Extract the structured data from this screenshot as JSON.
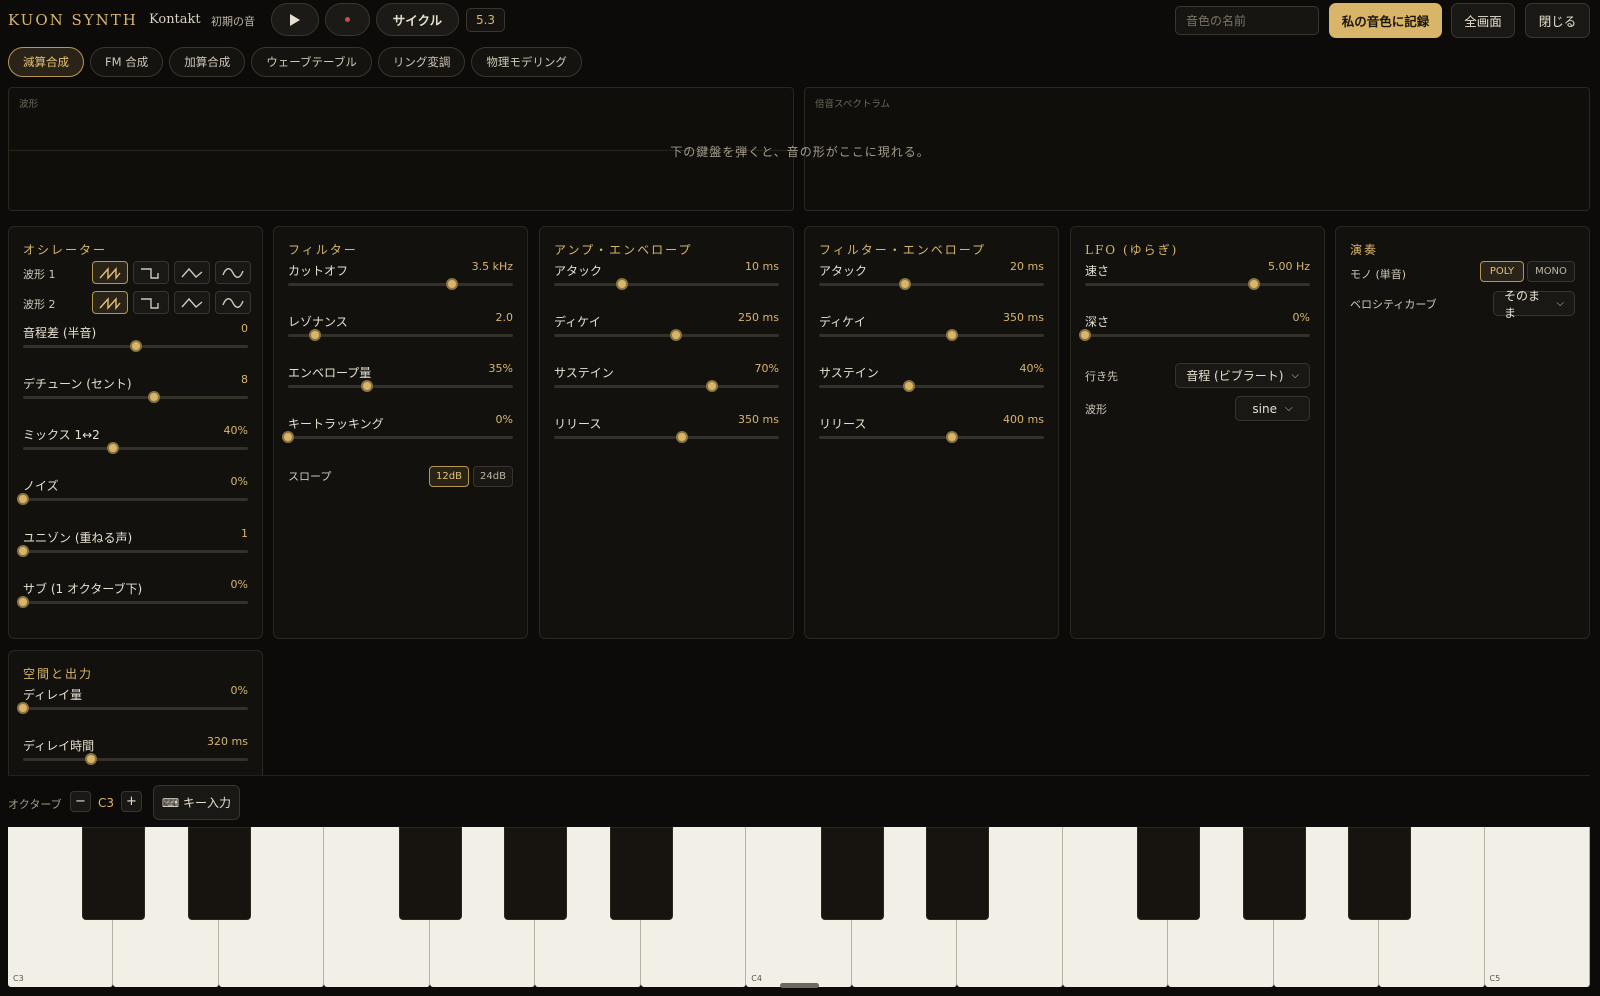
{
  "header": {
    "brand": "KUON SYNTH",
    "engine": "Kontakt",
    "preset_name": "初期の音",
    "cycle_label": "サイクル",
    "bpm_value": "5.3",
    "name_placeholder": "音色の名前",
    "save_label": "私の音色に記録",
    "fullscreen_label": "全画面",
    "close_label": "閉じる"
  },
  "synth_tabs": [
    {
      "label": "減算合成",
      "active": true
    },
    {
      "label": "FM 合成",
      "active": false
    },
    {
      "label": "加算合成",
      "active": false
    },
    {
      "label": "ウェーブテーブル",
      "active": false
    },
    {
      "label": "リング変調",
      "active": false
    },
    {
      "label": "物理モデリング",
      "active": false
    }
  ],
  "displays": {
    "waveform_label": "波形",
    "spectrum_label": "倍音スペクトラム",
    "hint": "下の鍵盤を弾くと、音の形がここに現れる。"
  },
  "oscillator": {
    "title": "オシレーター",
    "wave1_label": "波形 1",
    "wave2_label": "波形 2",
    "wave_options": [
      "saw",
      "square",
      "triangle",
      "sine"
    ],
    "wave1_selected": "saw",
    "wave2_selected": "saw",
    "params": [
      {
        "label": "音程差 (半音)",
        "value": "0",
        "level": 0.5
      },
      {
        "label": "デチューン (セント)",
        "value": "8",
        "level": 0.58
      },
      {
        "label": "ミックス 1↔2",
        "value": "40%",
        "level": 0.4
      },
      {
        "label": "ノイズ",
        "value": "0%",
        "level": 0.0
      },
      {
        "label": "ユニゾン (重ねる声)",
        "value": "1",
        "level": 0.0
      },
      {
        "label": "サブ (1 オクターブ下)",
        "value": "0%",
        "level": 0.0
      }
    ]
  },
  "filter": {
    "title": "フィルター",
    "params": [
      {
        "label": "カットオフ",
        "value": "3.5 kHz",
        "level": 0.73
      },
      {
        "label": "レゾナンス",
        "value": "2.0",
        "level": 0.12
      },
      {
        "label": "エンベロープ量",
        "value": "35%",
        "level": 0.35
      },
      {
        "label": "キートラッキング",
        "value": "0%",
        "level": 0.0
      }
    ],
    "slope_label": "スロープ",
    "slope_options": [
      "12dB",
      "24dB"
    ],
    "slope_selected": "12dB"
  },
  "amp_env": {
    "title": "アンプ・エンベロープ",
    "params": [
      {
        "label": "アタック",
        "value": "10 ms",
        "level": 0.3
      },
      {
        "label": "ディケイ",
        "value": "250 ms",
        "level": 0.54
      },
      {
        "label": "サステイン",
        "value": "70%",
        "level": 0.7
      },
      {
        "label": "リリース",
        "value": "350 ms",
        "level": 0.57
      }
    ]
  },
  "filter_env": {
    "title": "フィルター・エンベロープ",
    "params": [
      {
        "label": "アタック",
        "value": "20 ms",
        "level": 0.38
      },
      {
        "label": "ディケイ",
        "value": "350 ms",
        "level": 0.59
      },
      {
        "label": "サステイン",
        "value": "40%",
        "level": 0.4
      },
      {
        "label": "リリース",
        "value": "400 ms",
        "level": 0.59
      }
    ]
  },
  "lfo": {
    "title": "LFO (ゆらぎ)",
    "params": [
      {
        "label": "速さ",
        "value": "5.00 Hz",
        "level": 0.75
      },
      {
        "label": "深さ",
        "value": "0%",
        "level": 0.0
      }
    ],
    "dest_label": "行き先",
    "dest_value": "音程 (ビブラート)",
    "wave_label": "波形",
    "wave_value": "sine"
  },
  "play": {
    "title": "演奏",
    "mono_label": "モノ (単音)",
    "poly_label": "POLY",
    "mono_btn_label": "MONO",
    "mode_selected": "POLY",
    "velocity_label": "ベロシティカーブ",
    "velocity_value": "そのまま"
  },
  "space": {
    "title": "空間と出力",
    "params": [
      {
        "label": "ディレイ量",
        "value": "0%",
        "level": 0.0
      },
      {
        "label": "ディレイ時間",
        "value": "320 ms",
        "level": 0.3
      }
    ]
  },
  "keyboard": {
    "octave_label": "オクターブ",
    "octave_minus": "−",
    "octave_plus": "+",
    "octave_value": "C3",
    "key_input_label": "⌨ キー入力",
    "labels": {
      "c3": "C3",
      "c4": "C4",
      "c5": "C5"
    }
  },
  "colors": {
    "accent": "#d9b569",
    "background": "#0c0b09",
    "panel": "#12110e"
  }
}
